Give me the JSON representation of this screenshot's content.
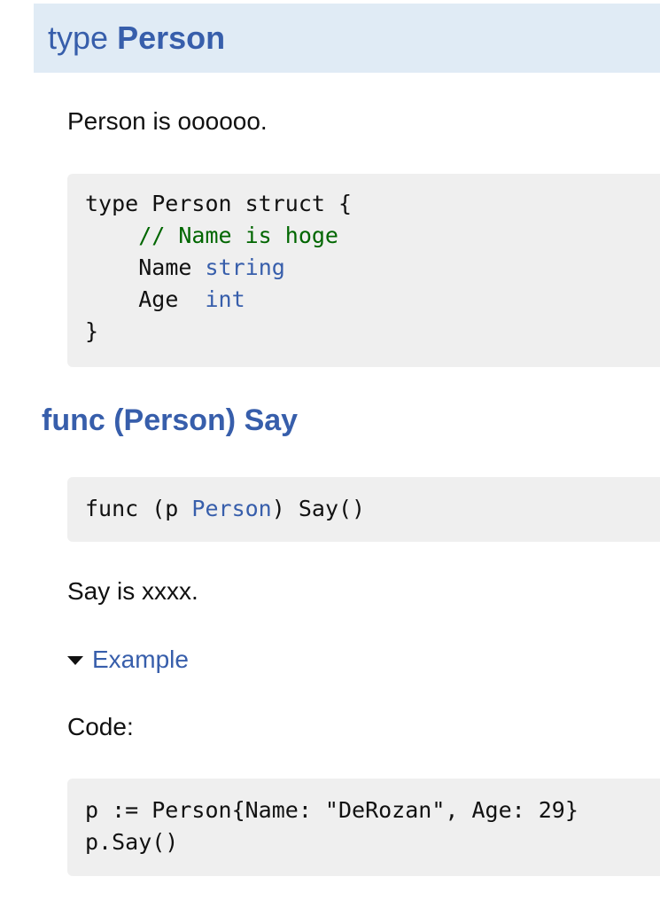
{
  "type_section": {
    "keyword": "type",
    "name": "Person",
    "description": "Person is oooooo.",
    "code": {
      "line1": "type Person struct {",
      "comment": "// Name is hoge",
      "field1_name": "Name",
      "field1_type": "string",
      "field2_name": "Age",
      "field2_type": "int",
      "closing": "}"
    }
  },
  "method_section": {
    "heading": "func (Person) Say",
    "signature": {
      "prefix": "func (p ",
      "receiver_type": "Person",
      "suffix": ") Say()"
    },
    "description": "Say is xxxx.",
    "example_toggle": "Example",
    "code_label": "Code:",
    "example_code": {
      "line1": "p := Person{Name: \"DeRozan\", Age: 29}",
      "line2": "p.Say()"
    }
  },
  "colors": {
    "link_blue": "#375eab",
    "header_bg": "#e0ebf5",
    "code_bg": "#efefef",
    "comment_green": "#006600"
  }
}
